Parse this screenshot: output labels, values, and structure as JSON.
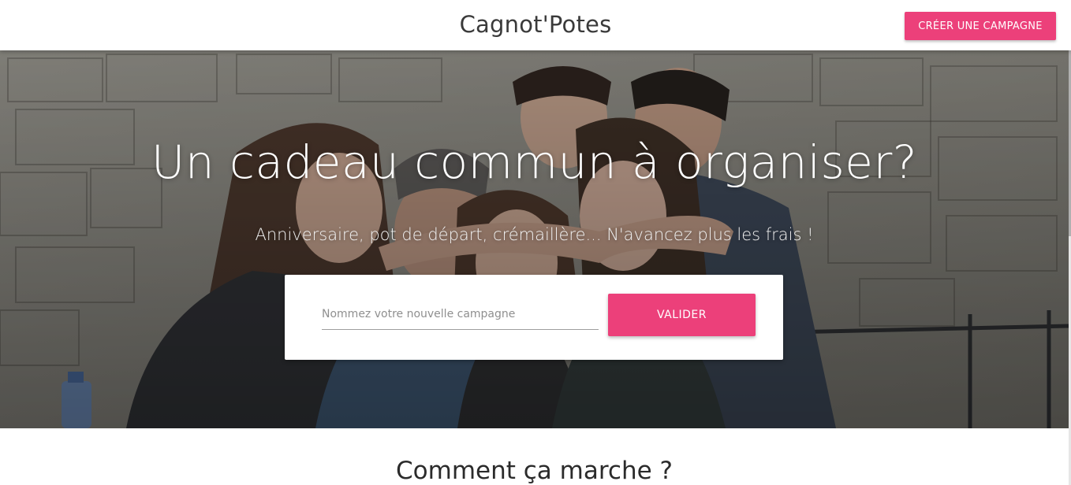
{
  "header": {
    "brand": "Cagnot'Potes",
    "create_button": "CRÉER UNE CAMPAGNE"
  },
  "hero": {
    "title": "Un cadeau commun à organiser?",
    "subtitle": "Anniversaire, pot de départ, crémaillère... N'avancez plus les frais !",
    "image_description": "group-of-friends-hugging-photo",
    "form": {
      "input_placeholder": "Nommez votre nouvelle campagne",
      "input_value": "",
      "submit_label": "VALIDER"
    }
  },
  "section": {
    "how_it_works_title": "Comment ça marche ?"
  },
  "colors": {
    "accent": "#ec407a",
    "header_bg": "#ffffff",
    "text_dark": "#3a3a3a"
  }
}
